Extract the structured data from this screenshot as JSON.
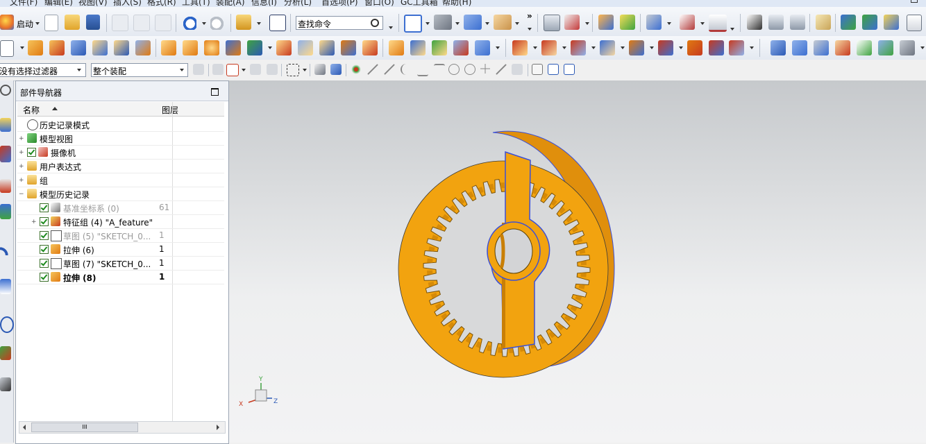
{
  "menu": [
    "文件(F)",
    "编辑(E)",
    "视图(V)",
    "插入(S)",
    "格式(R)",
    "工具(T)",
    "装配(A)",
    "信息(I)",
    "分析(L)",
    "首选项(P)",
    "窗口(O)",
    "GC工具箱",
    "帮助(H)"
  ],
  "toolbar": {
    "start_label": "启动",
    "command_search_value": "查找命令",
    "more_glyph": "»"
  },
  "selection_bar": {
    "filter_value": "没有选择过滤器",
    "scope_value": "整个装配"
  },
  "navigator": {
    "title": "部件导航器",
    "col_name": "名称",
    "col_layer": "图层",
    "rows": [
      {
        "label": "历史记录模式",
        "layer": "",
        "icon": "clock-icon",
        "check": false,
        "expander": ""
      },
      {
        "label": "模型视图",
        "layer": "",
        "icon": "model-view-icon",
        "check": false,
        "expander": "+"
      },
      {
        "label": "摄像机",
        "layer": "",
        "icon": "camera-icon",
        "check": true,
        "expander": "+"
      },
      {
        "label": "用户表达式",
        "layer": "",
        "icon": "folder-icon",
        "check": false,
        "expander": "+"
      },
      {
        "label": "组",
        "layer": "",
        "icon": "folder-icon",
        "check": false,
        "expander": "+"
      },
      {
        "label": "模型历史记录",
        "layer": "",
        "icon": "folder-icon",
        "check": false,
        "expander": "−"
      },
      {
        "label": "基准坐标系 (0)",
        "layer": "61",
        "icon": "datum-csys-icon",
        "check": true,
        "expander": "",
        "muted": true
      },
      {
        "label": "特征组 (4) \"A_feature\"",
        "layer": "",
        "icon": "feature-group-icon",
        "check": true,
        "expander": "+"
      },
      {
        "label": "草图 (5) \"SKETCH_0...",
        "layer": "1",
        "icon": "sketch-icon",
        "check": true,
        "expander": "",
        "muted": true
      },
      {
        "label": "拉伸 (6)",
        "layer": "1",
        "icon": "extrude-icon",
        "check": true,
        "expander": ""
      },
      {
        "label": "草图 (7) \"SKETCH_0...",
        "layer": "1",
        "icon": "sketch-icon",
        "check": true,
        "expander": ""
      },
      {
        "label": "拉伸 (8)",
        "layer": "1",
        "icon": "extrude-icon",
        "check": true,
        "expander": "",
        "bold": true
      }
    ],
    "scroll_glyph": "III"
  },
  "triad": {
    "x_label": "X",
    "y_label": "Y",
    "z_label": "Z"
  },
  "colors": {
    "gear": "#f2a30f",
    "gear_dark": "#c97f06",
    "gear_edge": "#3a4fd8",
    "viewport_top": "#c6c9cc"
  }
}
